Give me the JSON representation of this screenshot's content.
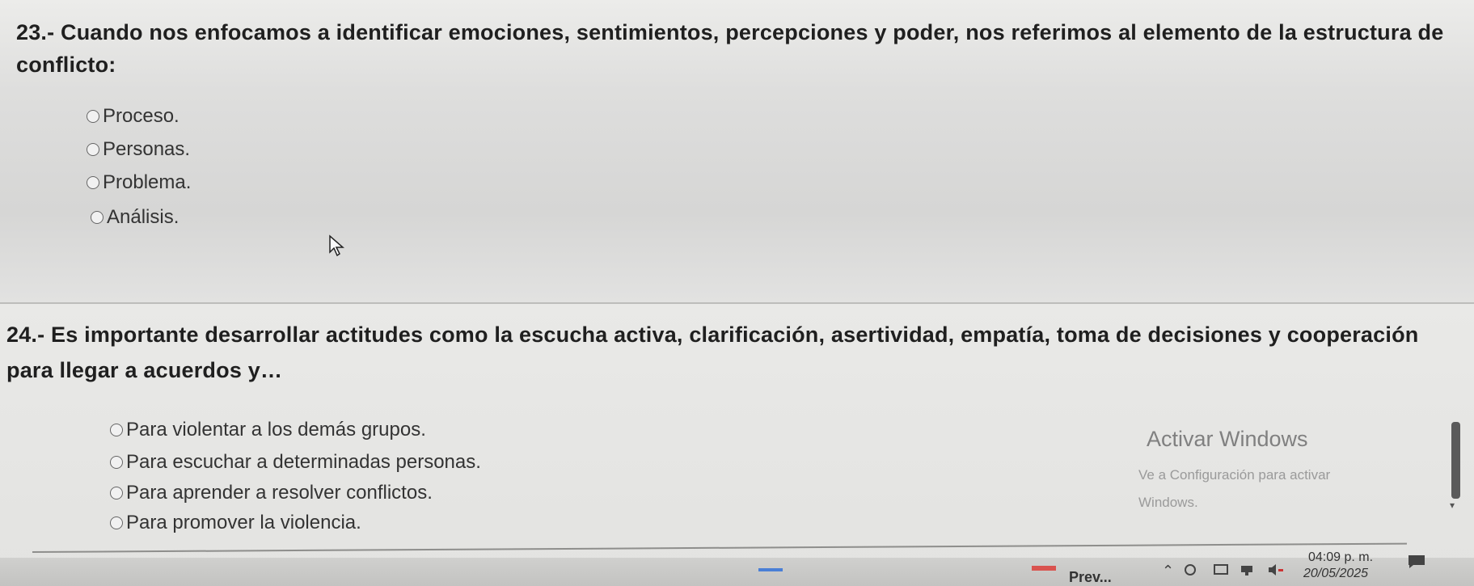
{
  "questions": [
    {
      "title": "23.- Cuando nos enfocamos a identificar emociones, sentimientos, percepciones y poder, nos referimos al elemento de la estructura de conflicto:",
      "options": [
        "Proceso.",
        "Personas.",
        "Problema.",
        "Análisis."
      ]
    },
    {
      "title": "24.- Es importante desarrollar actitudes como la escucha activa, clarificación, asertividad, empatía, toma de decisiones y cooperación para llegar a acuerdos y…",
      "options": [
        "Para violentar a los demás grupos.",
        "Para escuchar a determinadas personas.",
        "Para aprender a resolver conflictos.",
        "Para promover la violencia."
      ]
    }
  ],
  "watermark": {
    "title": "Activar Windows",
    "line1": "Ve a Configuración para activar",
    "line2": "Windows."
  },
  "taskbar": {
    "prev_label": "Prev...",
    "time": "04:09 p. m.",
    "date": "20/05/2025"
  },
  "icons": [
    "radio-circle-icon",
    "mouse-cursor-icon",
    "chevron-up-icon",
    "network-icon",
    "volume-icon",
    "notification-icon"
  ]
}
